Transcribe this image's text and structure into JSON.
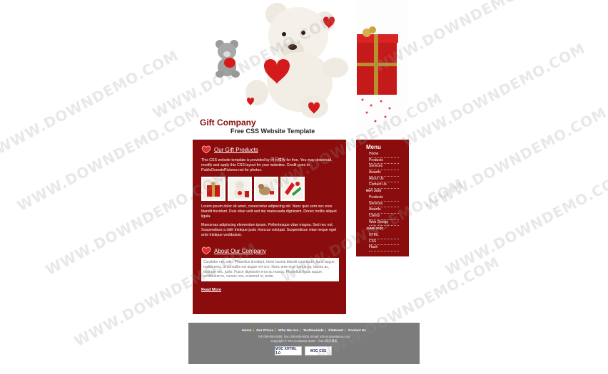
{
  "header": {
    "company": "Gift Company",
    "tagline": "Free CSS Website Template"
  },
  "main": {
    "heading1": "Our Gift Products",
    "intro": "This CSS website template is provided by 网页模板 for free. You may download, modify and apply this CSS layout for your websites. Credit goes to PublicDomainPictures.net for photos.",
    "para1": "Lorem ipsum dolor sit amet, consectetur adipiscing elit. Nunc quis sem nec eros blandit tincidunt. Duis vitae velit sed dui malesuada dignissim. Donec mollis aliquet ligula.",
    "para2": "Maecenas adipiscing elementum ipsum. Pellentesque vitae magna. Sed nec est. Suspendisse a nibh tristique justo rhoncus volutpat. Suspendisse vitae neque eget ante tristique vestibulum.",
    "heading2": "About Our Company",
    "about_text": "Curabitur nec odio. Phasellus tincidunt, tortor lacinia blandit commodo, nunc augue mattis eros, ut convallis est augue vel orci. Nunc ante erat, varius eu, lacinia ac, tristique nec, justo. Fusce dignissim eros ac massa. Phasellus ligula augue, vestibulum in, cursus non, euismod et, pede.",
    "read_more": "Read More"
  },
  "sidebar": {
    "title": "Menu",
    "menu": [
      "Home",
      "Products",
      "Services",
      "Awards",
      "About Us",
      "Contact Us"
    ],
    "month1": "MAY 2020",
    "may": [
      "Products",
      "Services",
      "Awards",
      "Clients",
      "Web Design"
    ],
    "month2": "JUNE 2020",
    "june": [
      "HTML",
      "CSS",
      "Flash"
    ]
  },
  "footer": {
    "nav": [
      "Home",
      "Our Prices",
      "Who We Are",
      "Testimonials",
      "Pinterest",
      "Contact Us"
    ],
    "contact": "Tel: 000-000-0000, Fax: 000-000-0000, Email: info at downdemo.com",
    "copyright": "Copyright © Your Company Name · from 网页模板",
    "badge1": "W3C XHTML 1.0",
    "badge2": "W3C CSS"
  },
  "watermark": "WWW.DOWNDEMO.COM",
  "colors": {
    "brand": "#8b0c0c",
    "footer": "#7c7c7c"
  }
}
